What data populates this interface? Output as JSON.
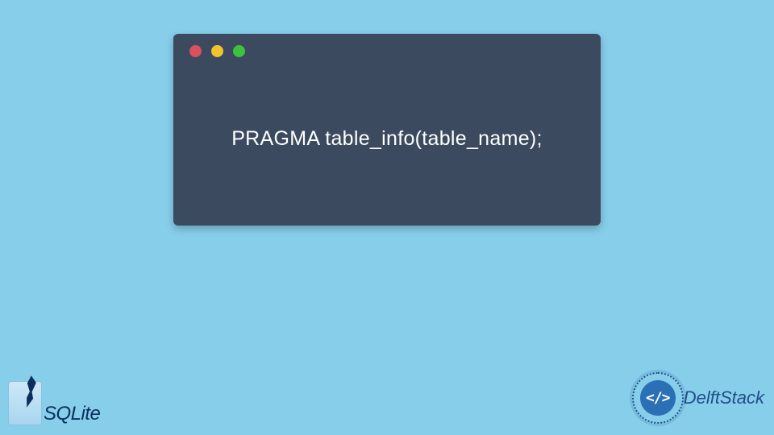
{
  "code_window": {
    "content": "PRAGMA table_info(table_name);"
  },
  "logos": {
    "sqlite": "SQLite",
    "delftstack": {
      "symbol": "</>",
      "text": "DelftStack"
    }
  },
  "colors": {
    "bg": "#87ceeb",
    "window": "#3c4a5f",
    "dot_red": "#d9515d",
    "dot_yellow": "#f4c430",
    "dot_green": "#3ec23e"
  }
}
